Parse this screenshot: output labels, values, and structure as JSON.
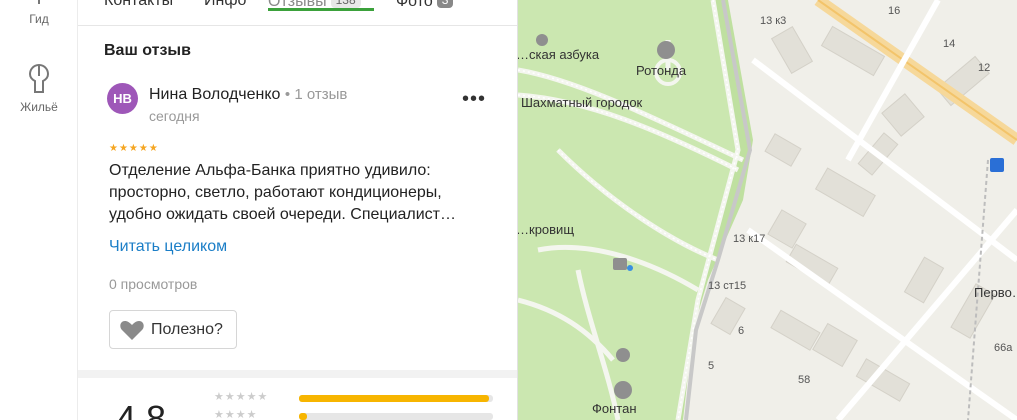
{
  "rail": {
    "items": [
      {
        "label": "Гид",
        "icon": "guide-icon"
      },
      {
        "label": "Жильё",
        "icon": "housing-icon"
      }
    ]
  },
  "tabs": [
    {
      "label": "Контакты"
    },
    {
      "label": "Инфо"
    },
    {
      "label": "Отзывы",
      "badge": "138",
      "active": true
    },
    {
      "label": "Фото",
      "badge": "3"
    }
  ],
  "review_section": {
    "title": "Ваш отзыв",
    "avatar_initials": "НВ",
    "avatar_color": "#9e57b8",
    "author": "Нина Володченко",
    "author_reviews": "1 отзыв",
    "date": "сегодня",
    "stars": 5,
    "stars_text": "★★★★★",
    "text_lines": [
      "Отделение Альфа-Банка приятно удивило:",
      "просторно, светло, работают кондиционеры,",
      "удобно ожидать своей очереди. Специалист…"
    ],
    "read_more": "Читать целиком",
    "views": "0 просмотров",
    "useful_label": "Полезно?",
    "more_menu": "•••"
  },
  "summary": {
    "rating": "4.8",
    "rows": [
      {
        "stars": "★★★★★",
        "fraction": 0.98
      },
      {
        "stars": "★★★★",
        "fraction": 0.04
      }
    ],
    "accent": "#f7b500"
  },
  "map": {
    "labels": {
      "azbuka": "…ская азбука",
      "rotonda": "Ротонда",
      "chess": "Шахматный городок",
      "treasure": "…кровищ",
      "fountain": "Фонтан",
      "pervo": "Перво…",
      "h13k3": "13 к3",
      "h16": "16",
      "h14": "14",
      "h12": "12",
      "h13k17": "13 к17",
      "h13st15": "13 ст15",
      "h6": "6",
      "h5": "5",
      "h58": "58",
      "h66a": "66а"
    }
  }
}
